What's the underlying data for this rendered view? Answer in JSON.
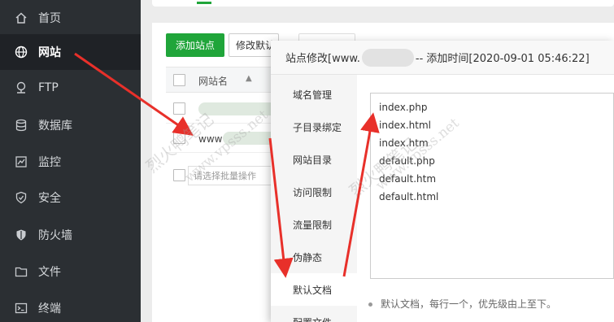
{
  "sidebar": {
    "items": [
      {
        "label": "首页",
        "icon": "home-icon"
      },
      {
        "label": "网站",
        "icon": "globe-icon",
        "active": true
      },
      {
        "label": "FTP",
        "icon": "ftp-icon"
      },
      {
        "label": "数据库",
        "icon": "database-icon"
      },
      {
        "label": "监控",
        "icon": "monitor-icon"
      },
      {
        "label": "安全",
        "icon": "shield-icon"
      },
      {
        "label": "防火墙",
        "icon": "firewall-icon"
      },
      {
        "label": "文件",
        "icon": "folder-icon"
      },
      {
        "label": "终端",
        "icon": "terminal-icon"
      }
    ]
  },
  "site_panel": {
    "add_button": "添加站点",
    "modify_button": "修改默认",
    "column_site_name": "网站名",
    "row_site_prefix": "www",
    "batch_placeholder": "请选择批量操作"
  },
  "dialog": {
    "title_prefix": "站点修改[www.",
    "title_suffix": "-- 添加时间[2020-09-01 05:46:22]",
    "menu": [
      "域名管理",
      "子目录绑定",
      "网站目录",
      "访问限制",
      "流量限制",
      "伪静态",
      "默认文档",
      "配置文件"
    ],
    "active_menu": "默认文档",
    "default_docs": [
      "index.php",
      "index.html",
      "index.htm",
      "default.php",
      "default.htm",
      "default.html"
    ],
    "hint": "默认文档，每行一个，优先级由上至下。"
  },
  "watermark": {
    "text_cn": "烈火鸭笔记",
    "text_url": "www.vpsss.net"
  },
  "colors": {
    "sidebar_bg": "#2b2f33",
    "accent_green": "#20a53a",
    "arrow_red": "#e8302a"
  }
}
